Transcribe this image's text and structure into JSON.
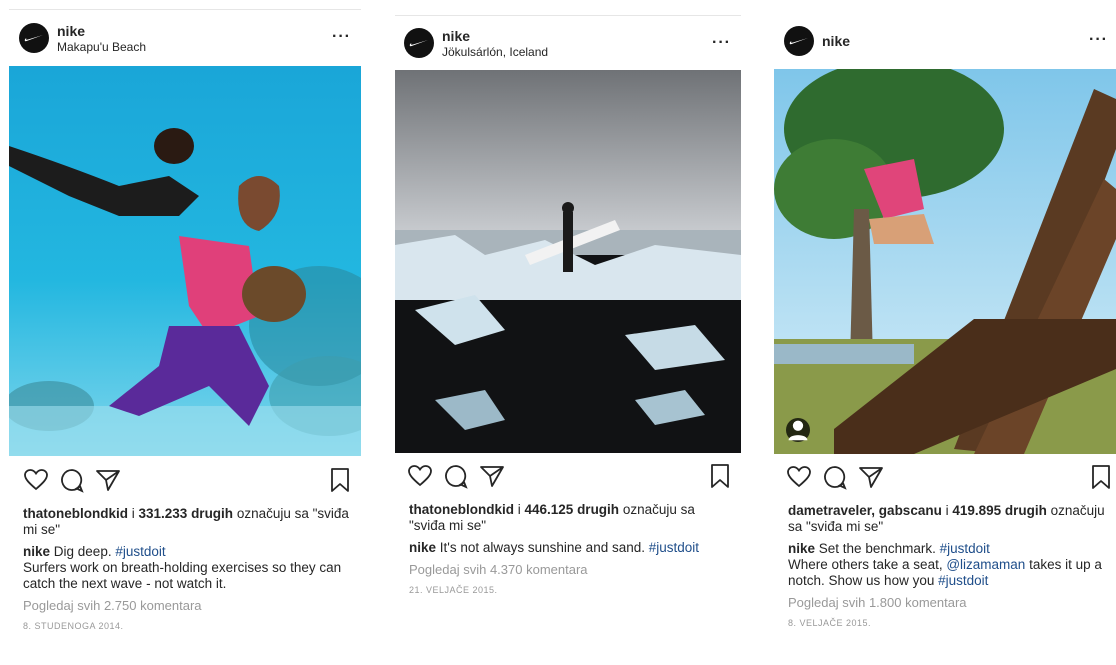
{
  "posts": [
    {
      "username": "nike",
      "location": "Makapu'u Beach",
      "likes_user": "thatoneblondkid",
      "likes_mid": " i ",
      "likes_count": "331.233 drugih",
      "likes_suffix": " označuju sa \"sviđa mi se\"",
      "caption_user": "nike",
      "caption_text": "Dig deep. ",
      "caption_tag": "#justdoit",
      "caption_extra": "Surfers work on breath-holding exercises so they can catch the next wave - not watch it.",
      "comments_link": "Pogledaj svih 2.750 komentara",
      "date": "8. STUDENOGA 2014."
    },
    {
      "username": "nike",
      "location": "Jökulsárlón, Iceland",
      "likes_user": "thatoneblondkid",
      "likes_mid": " i ",
      "likes_count": "446.125 drugih",
      "likes_suffix": " označuju sa \"sviđa mi se\"",
      "caption_user": "nike",
      "caption_text": "It's not always sunshine and sand. ",
      "caption_tag": "#justdoit",
      "comments_link": "Pogledaj svih 4.370 komentara",
      "date": "21. VELJAČE 2015."
    },
    {
      "username": "nike",
      "likes_user": "dametraveler, gabscanu",
      "likes_mid": " i ",
      "likes_count": "419.895 drugih",
      "likes_suffix": " označuju sa \"sviđa mi se\"",
      "caption_user": "nike",
      "caption_text": "Set the benchmark. ",
      "caption_tag": "#justdoit",
      "caption_extra_pre": "Where others take a seat, ",
      "caption_extra_mention": "@lizamaman",
      "caption_extra_mid": " takes it up a notch. Show us how you ",
      "caption_extra_tag": "#justdoit",
      "comments_link": "Pogledaj svih 1.800 komentara",
      "date": "8. VELJAČE 2015."
    }
  ],
  "more_label": "···",
  "icons": [
    "heart-icon",
    "comment-icon",
    "share-icon",
    "bookmark-icon",
    "more-icon",
    "nike-swoosh-logo",
    "tagged-user-icon"
  ],
  "colors": {
    "hashtag": "#1f4e8a",
    "muted": "#999999",
    "text": "#262626"
  }
}
